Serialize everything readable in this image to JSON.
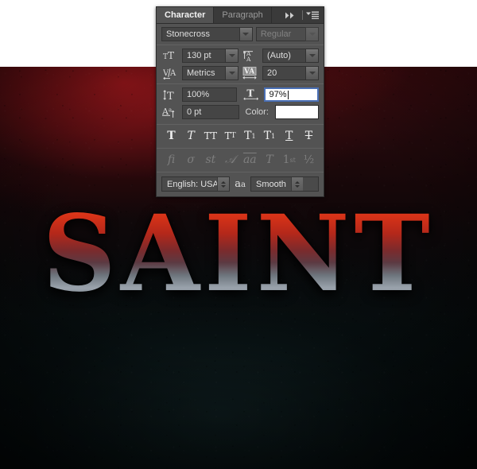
{
  "app": {
    "document_title": "SAINT",
    "artwork_text": "SAINT"
  },
  "panel": {
    "tabs": [
      {
        "label": "Character",
        "active": true
      },
      {
        "label": "Paragraph",
        "active": false
      }
    ],
    "collapse_icon": "▶▶",
    "menu_icon": "panel-menu-icon",
    "font_family": {
      "value": "Stonecross",
      "icon": "chevron-down-icon"
    },
    "font_style": {
      "value": "Regular",
      "icon": "chevron-down-icon",
      "disabled": true
    },
    "font_size": {
      "icon": "font-size-icon",
      "value": "130 pt"
    },
    "leading": {
      "icon": "leading-icon",
      "value": "(Auto)"
    },
    "kerning": {
      "icon": "kerning-icon",
      "value": "Metrics"
    },
    "tracking": {
      "icon": "tracking-icon",
      "value": "20"
    },
    "vertical_scale": {
      "icon": "vertical-scale-icon",
      "value": "100%"
    },
    "horizontal_scale": {
      "icon": "horizontal-scale-icon",
      "value": "97%",
      "focused": true
    },
    "baseline_shift": {
      "icon": "baseline-shift-icon",
      "value": "0 pt"
    },
    "color": {
      "label": "Color:",
      "swatch_hex": "#ffffff"
    },
    "style_buttons": [
      {
        "name": "faux-bold-button",
        "glyph": "T"
      },
      {
        "name": "faux-italic-button",
        "glyph": "T"
      },
      {
        "name": "all-caps-button",
        "glyph": "TT"
      },
      {
        "name": "small-caps-button",
        "glyph": "TT"
      },
      {
        "name": "superscript-button",
        "glyph": "T"
      },
      {
        "name": "subscript-button",
        "glyph": "T"
      },
      {
        "name": "underline-button",
        "glyph": "T"
      },
      {
        "name": "strikethrough-button",
        "glyph": "T"
      }
    ],
    "opentype_buttons": [
      {
        "name": "standard-ligatures-button",
        "glyph": "fi"
      },
      {
        "name": "contextual-alternates-button",
        "glyph": "σ"
      },
      {
        "name": "discretionary-ligatures-button",
        "glyph": "st"
      },
      {
        "name": "swash-button",
        "glyph": "𝒜"
      },
      {
        "name": "oldstyle-button",
        "glyph": "aa"
      },
      {
        "name": "titling-alternates-button",
        "glyph": "T"
      },
      {
        "name": "ordinals-button",
        "glyph": "1st"
      },
      {
        "name": "fractions-button",
        "glyph": "½"
      }
    ],
    "language": {
      "value": "English: USA"
    },
    "antialias_icon": "aa",
    "antialias": {
      "value": "Smooth"
    }
  },
  "colors": {
    "panel_bg": "#535353",
    "panel_tab_bg": "#3a3a3a",
    "field_bg": "#454545",
    "focus_border": "#4a6fb5",
    "canvas_strip": "#ffffff",
    "artwork_red": "#96161a",
    "artwork_dark": "#050708"
  }
}
